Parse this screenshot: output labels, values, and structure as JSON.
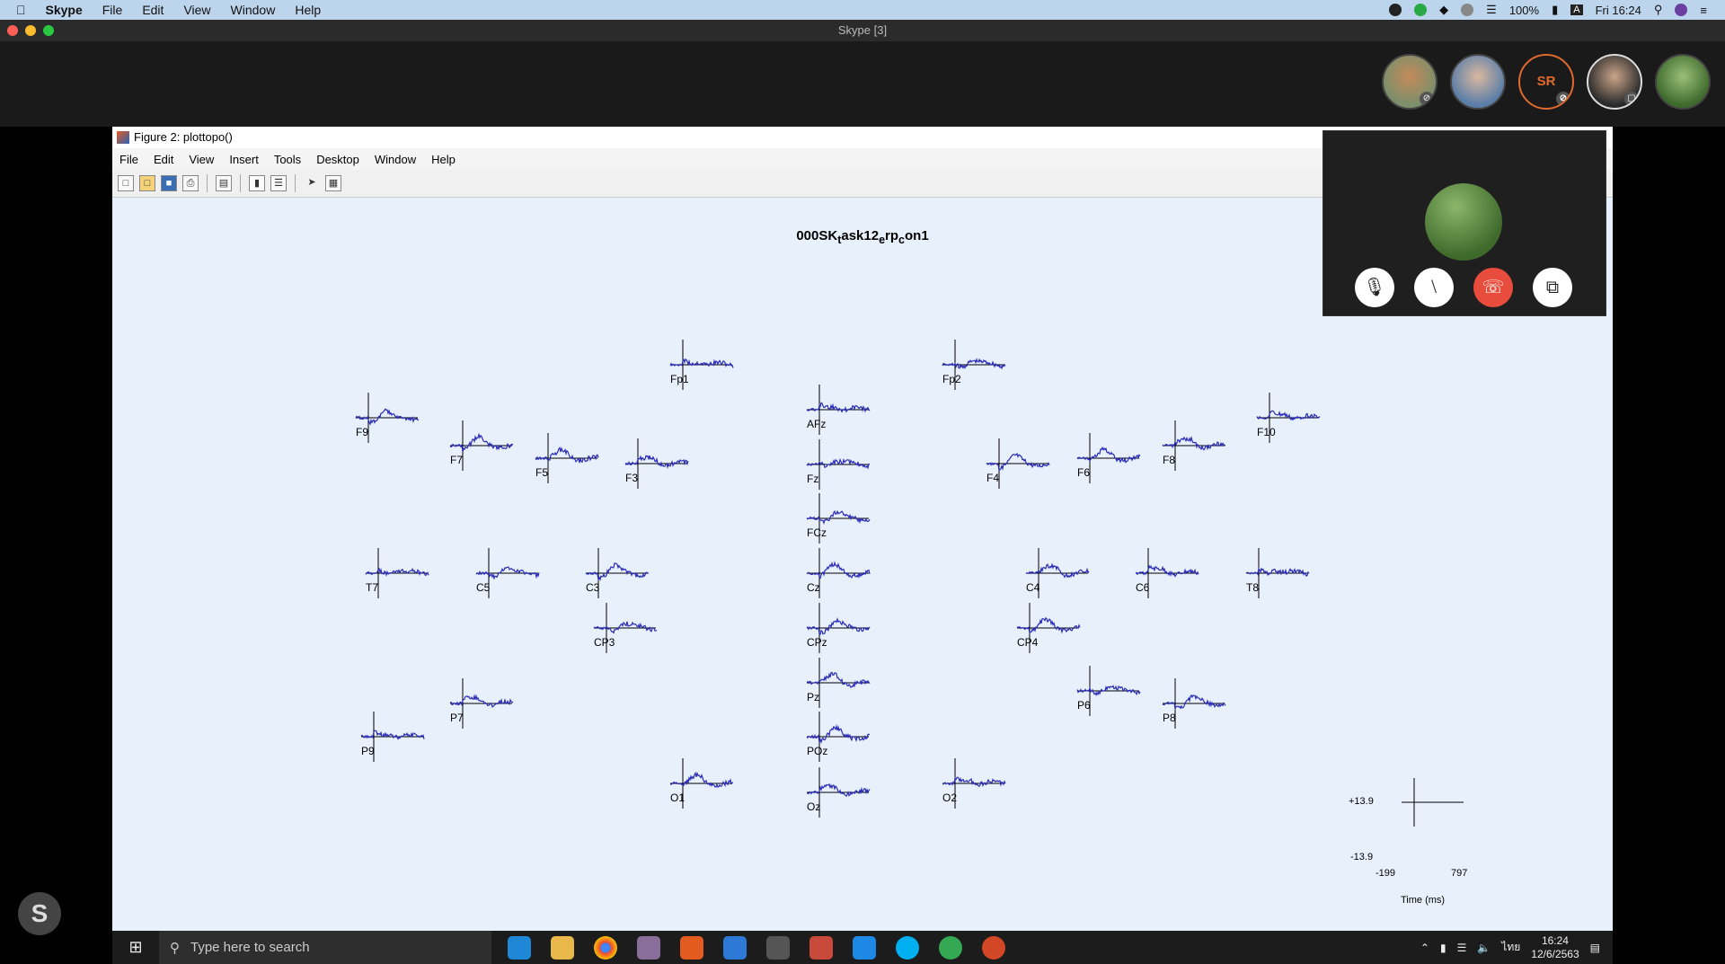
{
  "mac_menubar": {
    "app_name": "Skype",
    "menu": [
      "File",
      "Edit",
      "View",
      "Window",
      "Help"
    ],
    "battery": "100%",
    "clock": "Fri 16:24"
  },
  "skype": {
    "window_title": "Skype [3]",
    "participants": [
      {
        "initials": "",
        "muted": true
      },
      {
        "initials": "",
        "muted": false
      },
      {
        "initials": "SR",
        "muted": true
      },
      {
        "initials": "",
        "muted": false
      },
      {
        "initials": "",
        "muted": false
      }
    ],
    "call_controls": [
      "mic-icon",
      "video-off-icon",
      "end-call-icon",
      "popout-icon"
    ],
    "floating_button": "S"
  },
  "figure": {
    "window_title": "Figure 2: plottopo()",
    "menu": [
      "File",
      "Edit",
      "View",
      "Insert",
      "Tools",
      "Desktop",
      "Window",
      "Help"
    ],
    "toolbar": [
      "new-icon",
      "open-icon",
      "save-icon",
      "print-icon",
      "print-preview-icon",
      "colorbar-icon",
      "legend-icon",
      "select-icon",
      "plotbrowser-icon"
    ],
    "plot_title_parts": {
      "a": "000SK",
      "b": "t",
      "c": "ask12",
      "d": "e",
      "e": "rp",
      "f": "c",
      "g": "on1"
    },
    "scale": {
      "ymax": "+13.9",
      "ymin": "-13.9",
      "xmin": "-199",
      "xmax": "797",
      "xlabel": "Time (ms)"
    }
  },
  "chart_data": {
    "type": "line",
    "title": "000SKtask12erpcon1",
    "xlabel": "Time (ms)",
    "xlim": [
      -199,
      797
    ],
    "ylim": [
      -13.9,
      13.9
    ],
    "channels": [
      "Fp1",
      "Fp2",
      "F9",
      "F7",
      "F5",
      "F3",
      "AFz",
      "Fz",
      "FCz",
      "F4",
      "F6",
      "F8",
      "F10",
      "T7",
      "C5",
      "C3",
      "Cz",
      "C4",
      "C6",
      "T8",
      "CP3",
      "CPz",
      "CP4",
      "Pz",
      "P7",
      "P9",
      "P6",
      "P8",
      "POz",
      "O1",
      "Oz",
      "O2"
    ]
  },
  "taskbar": {
    "search_placeholder": "Type here to search",
    "time": "16:24",
    "date": "12/6/2563",
    "lang": "ไทย"
  }
}
